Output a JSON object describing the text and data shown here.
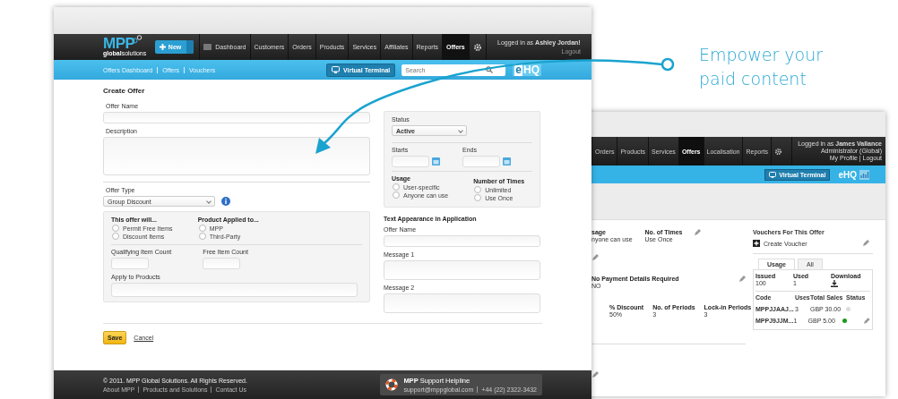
{
  "tagline": "Empower your paid content",
  "front": {
    "logo": {
      "mark": "MPP",
      "sub": "**global**solutions"
    },
    "new_button": "New",
    "nav": [
      {
        "label": "Dashboard",
        "selected": false
      },
      {
        "label": "Customers",
        "selected": false
      },
      {
        "label": "Orders",
        "selected": false
      },
      {
        "label": "Products",
        "selected": false
      },
      {
        "label": "Services",
        "selected": false
      },
      {
        "label": "Affiliates",
        "selected": false
      },
      {
        "label": "Reports",
        "selected": false
      },
      {
        "label": "Offers",
        "selected": true
      }
    ],
    "user": {
      "greeting": "Logged in as **Ashley Jordan!**",
      "link": "Logout"
    },
    "subnav": [
      "Offers Dashboard",
      "Offers",
      "Vouchers"
    ],
    "virtual_terminal": "Virtual Terminal",
    "search": {
      "placeholder": "Search"
    },
    "brand": {
      "e": "e",
      "hq": "HQ"
    },
    "page_title": "Create Offer",
    "offer_name": {
      "label": "Offer Name"
    },
    "description": {
      "label": "Description"
    },
    "offer_type": {
      "label": "Offer Type",
      "value": "Group Discount"
    },
    "rules": {
      "groups": [
        {
          "title": "This offer will...",
          "options": [
            {
              "label": "Permit Free Items",
              "selected": false
            },
            {
              "label": "Discount Items",
              "selected": false
            }
          ]
        },
        {
          "title": "Product Applied to...",
          "options": [
            {
              "label": "MPP",
              "selected": false
            },
            {
              "label": "Third-Party",
              "selected": false
            }
          ]
        }
      ],
      "counts": [
        {
          "label": "Qualifying Item Count"
        },
        {
          "label": "Free Item Count"
        }
      ],
      "apply_to": {
        "label": "Apply to Products"
      }
    },
    "status": {
      "label": "Status",
      "value": "Active"
    },
    "dates": [
      {
        "label": "Starts"
      },
      {
        "label": "Ends"
      }
    ],
    "limits": [
      {
        "title": "Usage",
        "options": [
          {
            "label": "User-specific",
            "selected": false
          },
          {
            "label": "Anyone can use",
            "selected": false
          }
        ]
      },
      {
        "title": "Number of Times",
        "options": [
          {
            "label": "Unlimited",
            "selected": false
          },
          {
            "label": "Use Once",
            "selected": false
          }
        ]
      }
    ],
    "appearance": {
      "title": "Text Appearance in Application",
      "fields": [
        {
          "label": "Offer Name",
          "kind": "line"
        },
        {
          "label": "Message 1",
          "kind": "box"
        },
        {
          "label": "Message 2",
          "kind": "box"
        }
      ]
    },
    "actions": {
      "save": "Save",
      "cancel": "Cancel"
    },
    "footer": {
      "copyright": "© 2011. MPP Global Solutions. All Rights Reserved.",
      "links": [
        "About MPP",
        "Products and Solutions",
        "Contact Us"
      ],
      "helpline": {
        "title": "**MPP** Support Helpline",
        "email": "support@mppglobal.com",
        "phone": "+44 (22) 2322-3432"
      }
    }
  },
  "back": {
    "nav": [
      {
        "label": "Orders",
        "selected": false
      },
      {
        "label": "Products",
        "selected": false
      },
      {
        "label": "Services",
        "selected": false
      },
      {
        "label": "Offers",
        "selected": true
      },
      {
        "label": "Localisation",
        "selected": false
      },
      {
        "label": "Reports",
        "selected": false
      }
    ],
    "user": {
      "greeting": "Logged in as **James Vallance**",
      "role": "Administrator (Global)",
      "links": "My Profile | Logout"
    },
    "virtual_terminal": "Virtual Terminal",
    "brand": "eHQ",
    "sections": [
      {
        "fields": [
          {
            "label": "sage",
            "value": "nyone can use"
          },
          {
            "label": "No. of Times",
            "value": "Use Once"
          }
        ]
      },
      {
        "fields": [
          {
            "label": "No Payment Details Required",
            "value": "NO"
          }
        ]
      },
      {
        "fields": [
          {
            "label": "% Discount",
            "value": "50%"
          },
          {
            "label": "No. of Periods",
            "value": "3"
          },
          {
            "label": "Lock-in Periods",
            "value": "3"
          }
        ]
      }
    ],
    "vouchers": {
      "title": "Vouchers For This Offer",
      "create": "Create Voucher",
      "tabs": [
        {
          "label": "Usage",
          "selected": true
        },
        {
          "label": "All",
          "selected": false
        }
      ],
      "stats": [
        {
          "label": "Issued",
          "value": "100",
          "kind": "text"
        },
        {
          "label": "Used",
          "value": "1",
          "kind": "text"
        },
        {
          "label": "Download",
          "kind": "download"
        }
      ],
      "columns": [
        "Code",
        "Uses",
        "Total Sales",
        "Status"
      ],
      "rows": [
        {
          "code": "MPPJJAAJ...",
          "uses": "3",
          "sales": "GBP 30.00",
          "color": "#dddddd"
        },
        {
          "code": "MPPJ9JJM...",
          "uses": "1",
          "sales": "GBP 5.00",
          "color": "#1a9a1a"
        }
      ]
    }
  }
}
